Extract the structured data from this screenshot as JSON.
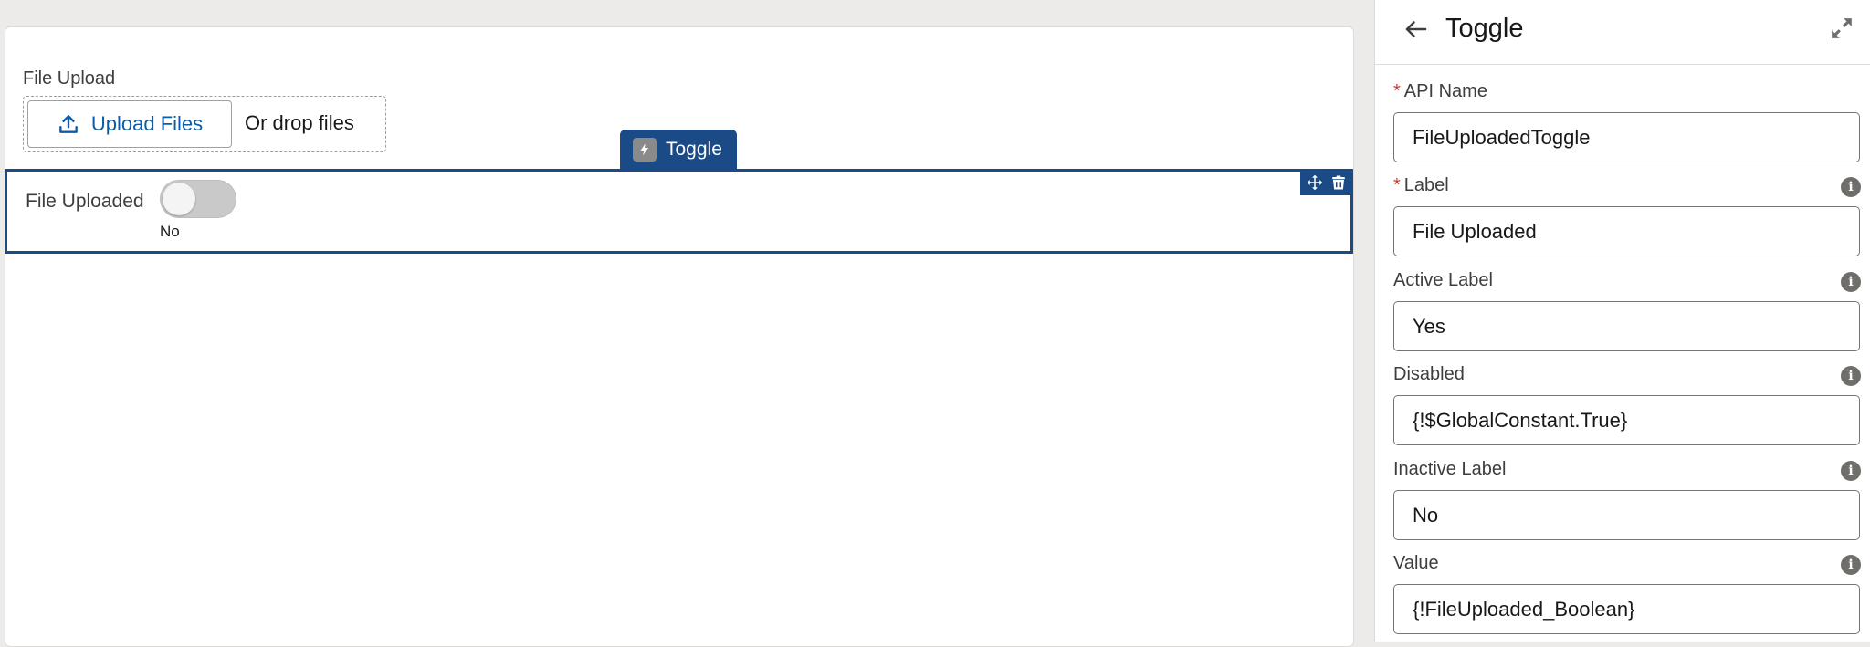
{
  "canvas": {
    "file_upload": {
      "label": "File Upload",
      "upload_button_label": "Upload Files",
      "drop_text": "Or drop files"
    },
    "selected_component": {
      "tab_label": "Toggle",
      "field_label": "File Uploaded",
      "toggle_state_text": "No",
      "toggle_on": false
    }
  },
  "panel": {
    "title": "Toggle",
    "fields": [
      {
        "label": "API Name",
        "required": true,
        "info": false,
        "value": "FileUploadedToggle"
      },
      {
        "label": "Label",
        "required": true,
        "info": true,
        "value": "File Uploaded"
      },
      {
        "label": "Active Label",
        "required": false,
        "info": true,
        "value": "Yes"
      },
      {
        "label": "Disabled",
        "required": false,
        "info": true,
        "value": "{!$GlobalConstant.True}"
      },
      {
        "label": "Inactive Label",
        "required": false,
        "info": true,
        "value": "No"
      },
      {
        "label": "Value",
        "required": false,
        "info": true,
        "value": "{!FileUploaded_Boolean}"
      }
    ]
  },
  "colors": {
    "accent": "#1b4b87",
    "link": "#0b5cab",
    "required": "#c23934",
    "canvas_bg": "#ecebea"
  },
  "icons": {
    "back": "arrow-left-icon",
    "expand": "expand-icon",
    "upload": "upload-icon",
    "tab": "flow-component-icon",
    "move": "move-icon",
    "delete": "trash-icon",
    "info": "info-icon"
  }
}
